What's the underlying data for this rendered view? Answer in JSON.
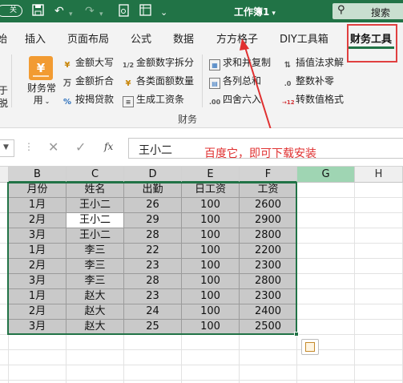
{
  "titlebar": {
    "autosave": "关",
    "title": "工作簿1",
    "title_caret": "▾",
    "search_label": "搜索",
    "icons": [
      "save-icon",
      "undo-icon",
      "redo-icon",
      "print-preview-icon",
      "page-layout-icon",
      "more-icon"
    ]
  },
  "tabs": {
    "partial": "始",
    "items": [
      "插入",
      "页面布局",
      "公式",
      "数据",
      "方方格子",
      "DIY工具箱",
      "财务工具"
    ],
    "active": "财务工具"
  },
  "ribbon": {
    "left_partial": [
      "于",
      "脱"
    ],
    "big_button": {
      "icon": "¥",
      "label_line1": "财务常",
      "label_line2": "用"
    },
    "buttons": [
      {
        "icon": "¥",
        "label": "金额大写"
      },
      {
        "icon": "万",
        "label": "金额折合"
      },
      {
        "icon": "%",
        "label": "按揭贷款"
      },
      {
        "icon": "1/2",
        "label": "金额数字拆分"
      },
      {
        "icon": "¥",
        "label": "各类面额数量"
      },
      {
        "icon": "≡",
        "label": "生成工资条"
      },
      {
        "icon": "▦",
        "label": "求和并复制"
      },
      {
        "icon": "▤",
        "label": "各列总和"
      },
      {
        "icon": ".00",
        "label": "四舍六入"
      },
      {
        "icon": "⇅",
        "label": "插值法求解"
      },
      {
        "icon": ".0",
        "label": "整数补零"
      },
      {
        "icon": "→12",
        "label": "转数值格式"
      }
    ],
    "group_label": "财务"
  },
  "formula_bar": {
    "cancel": "✕",
    "enter": "✓",
    "fx": "fx",
    "value": "王小二"
  },
  "annotation": "百度它，即可下载安装",
  "columns": [
    "B",
    "C",
    "D",
    "E",
    "F",
    "G",
    "H"
  ],
  "table": {
    "headers": [
      "月份",
      "姓名",
      "出勤",
      "日工资",
      "工资"
    ],
    "rows": [
      [
        "1月",
        "王小二",
        "26",
        "100",
        "2600"
      ],
      [
        "2月",
        "王小二",
        "29",
        "100",
        "2900"
      ],
      [
        "3月",
        "王小二",
        "28",
        "100",
        "2800"
      ],
      [
        "1月",
        "李三",
        "22",
        "100",
        "2200"
      ],
      [
        "2月",
        "李三",
        "23",
        "100",
        "2300"
      ],
      [
        "3月",
        "李三",
        "28",
        "100",
        "2800"
      ],
      [
        "1月",
        "赵大",
        "23",
        "100",
        "2300"
      ],
      [
        "2月",
        "赵大",
        "24",
        "100",
        "2400"
      ],
      [
        "3月",
        "赵大",
        "25",
        "100",
        "2500"
      ]
    ]
  },
  "colors": {
    "accent": "#217346",
    "annotation": "#e03030",
    "selection_fill": "#c9c9c9"
  }
}
